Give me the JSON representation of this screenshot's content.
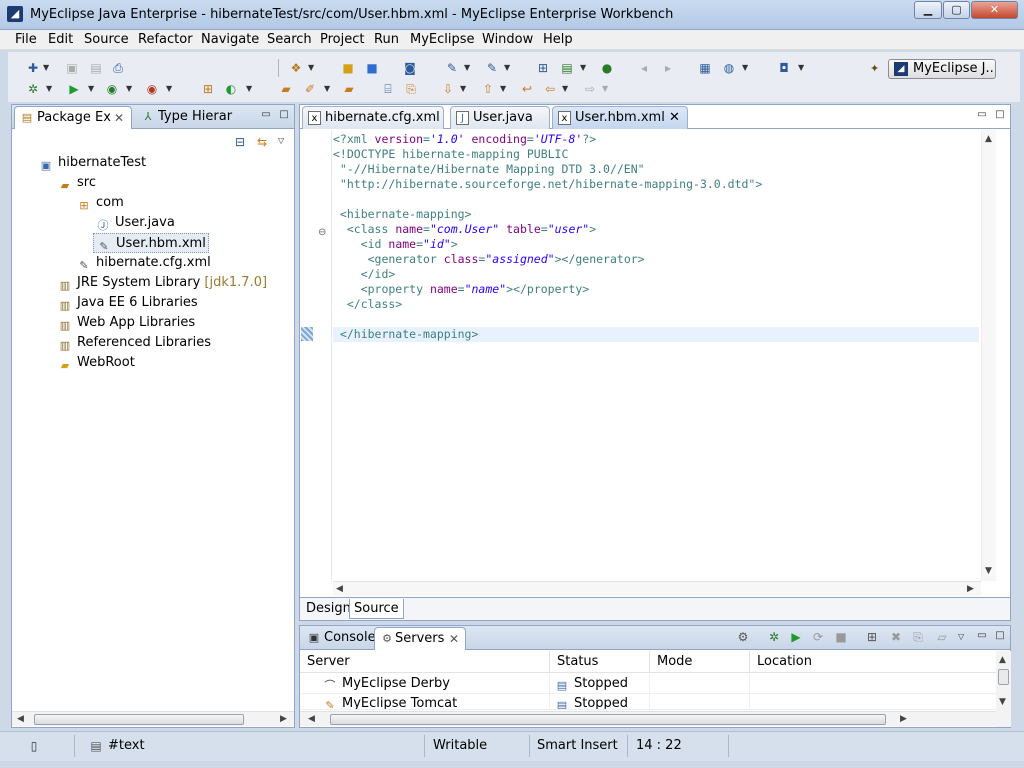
{
  "window": {
    "title": "MyEclipse Java Enterprise - hibernateTest/src/com/User.hbm.xml - MyEclipse Enterprise Workbench",
    "minimize_glyph": "▁",
    "maximize_glyph": "▢",
    "close_glyph": "✕"
  },
  "menu": [
    "File",
    "Edit",
    "Source",
    "Refactor",
    "Navigate",
    "Search",
    "Project",
    "Run",
    "MyEclipse",
    "Window",
    "Help"
  ],
  "perspective": {
    "label": "MyEclipse J..."
  },
  "left_panel": {
    "tabs": [
      {
        "label": "Package Ex",
        "close": "✕"
      },
      {
        "label": "Type Hierar"
      }
    ],
    "tree": [
      {
        "label": "hibernateTest",
        "icon": "project-icon"
      },
      {
        "label": "src",
        "icon": "source-folder-icon"
      },
      {
        "label": "com",
        "icon": "package-icon"
      },
      {
        "label": "User.java",
        "icon": "java-file-icon"
      },
      {
        "label": "User.hbm.xml",
        "icon": "xml-file-icon"
      },
      {
        "label": "hibernate.cfg.xml",
        "icon": "xml-file-icon"
      },
      {
        "label": "JRE System Library",
        "decoration": "[jdk1.7.0]",
        "icon": "library-icon"
      },
      {
        "label": "Java EE 6 Libraries",
        "icon": "library-icon"
      },
      {
        "label": "Web App Libraries",
        "icon": "library-icon"
      },
      {
        "label": "Referenced Libraries",
        "icon": "library-icon"
      },
      {
        "label": "WebRoot",
        "icon": "folder-icon"
      }
    ]
  },
  "editor": {
    "tabs": [
      {
        "label": "hibernate.cfg.xml",
        "active": false
      },
      {
        "label": "User.java",
        "active": false
      },
      {
        "label": "User.hbm.xml",
        "active": true,
        "close": "✕"
      }
    ],
    "subtabs": [
      "Design",
      "Source"
    ],
    "active_subtab": "Source",
    "code": {
      "line1": {
        "a": "<?xml ",
        "b": "version",
        "c": "=",
        "d": "'1.0'",
        "e": " encoding",
        "f": "=",
        "g": "'UTF-8'",
        "h": "?>"
      },
      "line2": "<!DOCTYPE hibernate-mapping PUBLIC",
      "line3": " \"-//Hibernate/Hibernate Mapping DTD 3.0//EN\"",
      "line4": " \"http://hibernate.sourceforge.net/hibernate-mapping-3.0.dtd\">",
      "line6": " <hibernate-mapping>",
      "line7": {
        "a": "  <class ",
        "b": "name",
        "c": "=",
        "d": "\"com.User\"",
        "e": " table",
        "f": "=",
        "g": "\"user\"",
        "h": ">"
      },
      "line8": {
        "a": "    <id ",
        "b": "name",
        "c": "=",
        "d": "\"id\"",
        "e": ">"
      },
      "line9": {
        "a": "     <generator ",
        "b": "class",
        "c": "=",
        "d": "\"assigned\"",
        "e": "></generator>"
      },
      "line10": "    </id>",
      "line11": {
        "a": "    <property ",
        "b": "name",
        "c": "=",
        "d": "\"name\"",
        "e": "></property>"
      },
      "line12": "  </class>",
      "line14": " </hibernate-mapping>"
    }
  },
  "bottom_panel": {
    "tabs": [
      {
        "label": "Console"
      },
      {
        "label": "Servers",
        "close": "✕"
      }
    ],
    "columns": [
      "Server",
      "Status",
      "Mode",
      "Location"
    ],
    "rows": [
      {
        "server": "MyEclipse Derby",
        "status": "Stopped",
        "mode": "",
        "location": ""
      },
      {
        "server": "MyEclipse Tomcat",
        "status": "Stopped",
        "mode": "",
        "location": ""
      }
    ]
  },
  "statusbar": {
    "text": "#text",
    "mode": "Writable",
    "insert": "Smart Insert",
    "position": "14 : 22"
  },
  "colors": {
    "xml_tag": "#3f7f7f",
    "xml_attribute": "#7f007f",
    "xml_value": "#2a00ff",
    "current_line": "#e8f2fe"
  }
}
